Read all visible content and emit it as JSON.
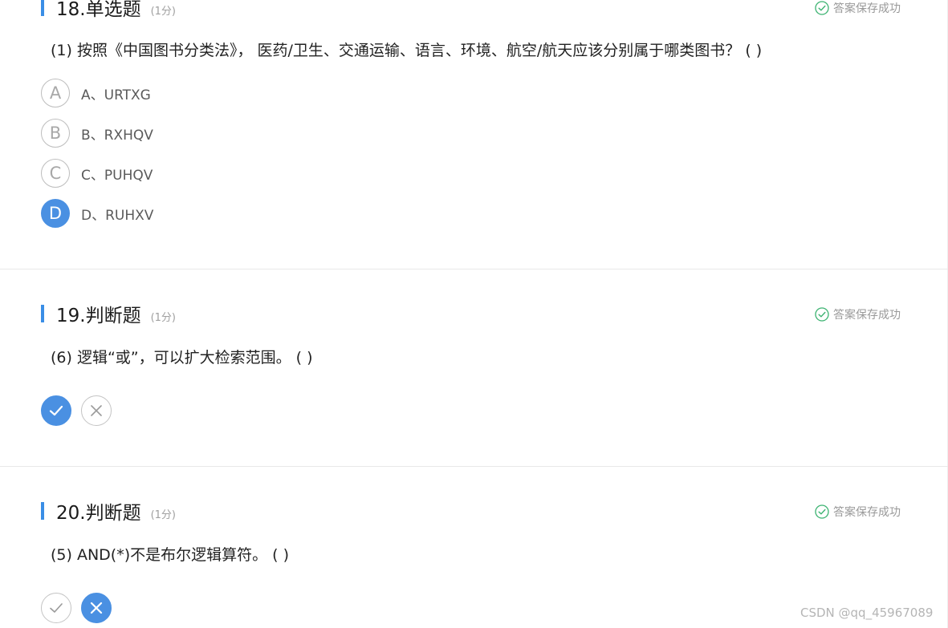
{
  "colors": {
    "accent": "#4a90e2",
    "success": "#3cb371",
    "bar": "#3a8ee6"
  },
  "questions": [
    {
      "title": "18.单选题",
      "score": "(1分)",
      "saved": "答案保存成功",
      "text": "(1)  按照《中国图书分类法》，  医药/卫生、交通运输、语言、环境、航空/航天应该分别属于哪类图书？  ( )",
      "options": [
        {
          "letter": "A",
          "label": "A、URTXG",
          "selected": false
        },
        {
          "letter": "B",
          "label": "B、RXHQV",
          "selected": false
        },
        {
          "letter": "C",
          "label": "C、PUHQV",
          "selected": false
        },
        {
          "letter": "D",
          "label": "D、RUHXV",
          "selected": true
        }
      ]
    },
    {
      "title": "19.判断题",
      "score": "(1分)",
      "saved": "答案保存成功",
      "text": "(6)   逻辑“或”，可以扩大检索范围。  ( )",
      "answer": "true"
    },
    {
      "title": "20.判断题",
      "score": "(1分)",
      "saved": "答案保存成功",
      "text": "(5)   AND(*)不是布尔逻辑算符。  ( )",
      "answer": "false"
    }
  ],
  "icons": {
    "saved": "check-circle-icon",
    "true_choice": "check-icon",
    "false_choice": "cross-icon"
  },
  "watermark": "CSDN @qq_45967089"
}
